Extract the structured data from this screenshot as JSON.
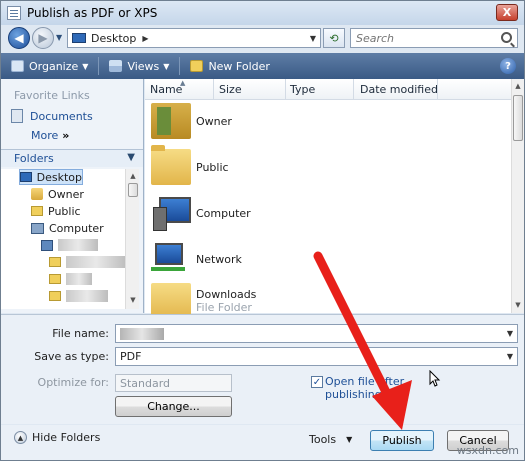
{
  "window": {
    "title": "Publish as PDF or XPS",
    "close_label": "X"
  },
  "address": {
    "location": "Desktop",
    "search_placeholder": "Search"
  },
  "toolbar": {
    "organize": "Organize",
    "views": "Views",
    "new_folder": "New Folder"
  },
  "left_pane": {
    "favorite_links_heading": "Favorite Links",
    "documents": "Documents",
    "more": "More",
    "folders_label": "Folders",
    "tree": [
      {
        "label": "Desktop",
        "icon": "desktop-icon"
      },
      {
        "label": "Owner",
        "icon": "user-folder-icon"
      },
      {
        "label": "Public",
        "icon": "folder-icon"
      },
      {
        "label": "Computer",
        "icon": "computer-icon"
      }
    ]
  },
  "columns": {
    "name": "Name",
    "size": "Size",
    "type": "Type",
    "date_modified": "Date modified"
  },
  "files": [
    {
      "name": "Owner",
      "icon": "user-folder-icon"
    },
    {
      "name": "Public",
      "icon": "folder-icon"
    },
    {
      "name": "Computer",
      "icon": "computer-icon"
    },
    {
      "name": "Network",
      "icon": "network-icon"
    },
    {
      "name": "Downloads",
      "sub": "File Folder",
      "icon": "folder-icon"
    }
  ],
  "form": {
    "file_name_label": "File name:",
    "save_as_type_label": "Save as type:",
    "save_as_type_value": "PDF",
    "optimize_for_label": "Optimize for:",
    "optimize_for_value": "Standard",
    "change_button": "Change...",
    "open_file_label_line1": "Open file after",
    "open_file_label_line2": "publishing",
    "open_file_checked": true
  },
  "footer": {
    "hide_folders": "Hide Folders",
    "tools": "Tools",
    "publish": "Publish",
    "cancel": "Cancel"
  },
  "watermark": "wsxdn.com",
  "colors": {
    "toolbar": "#3a5a85",
    "link": "#1e4f96",
    "annotation_arrow": "#e8201a"
  }
}
